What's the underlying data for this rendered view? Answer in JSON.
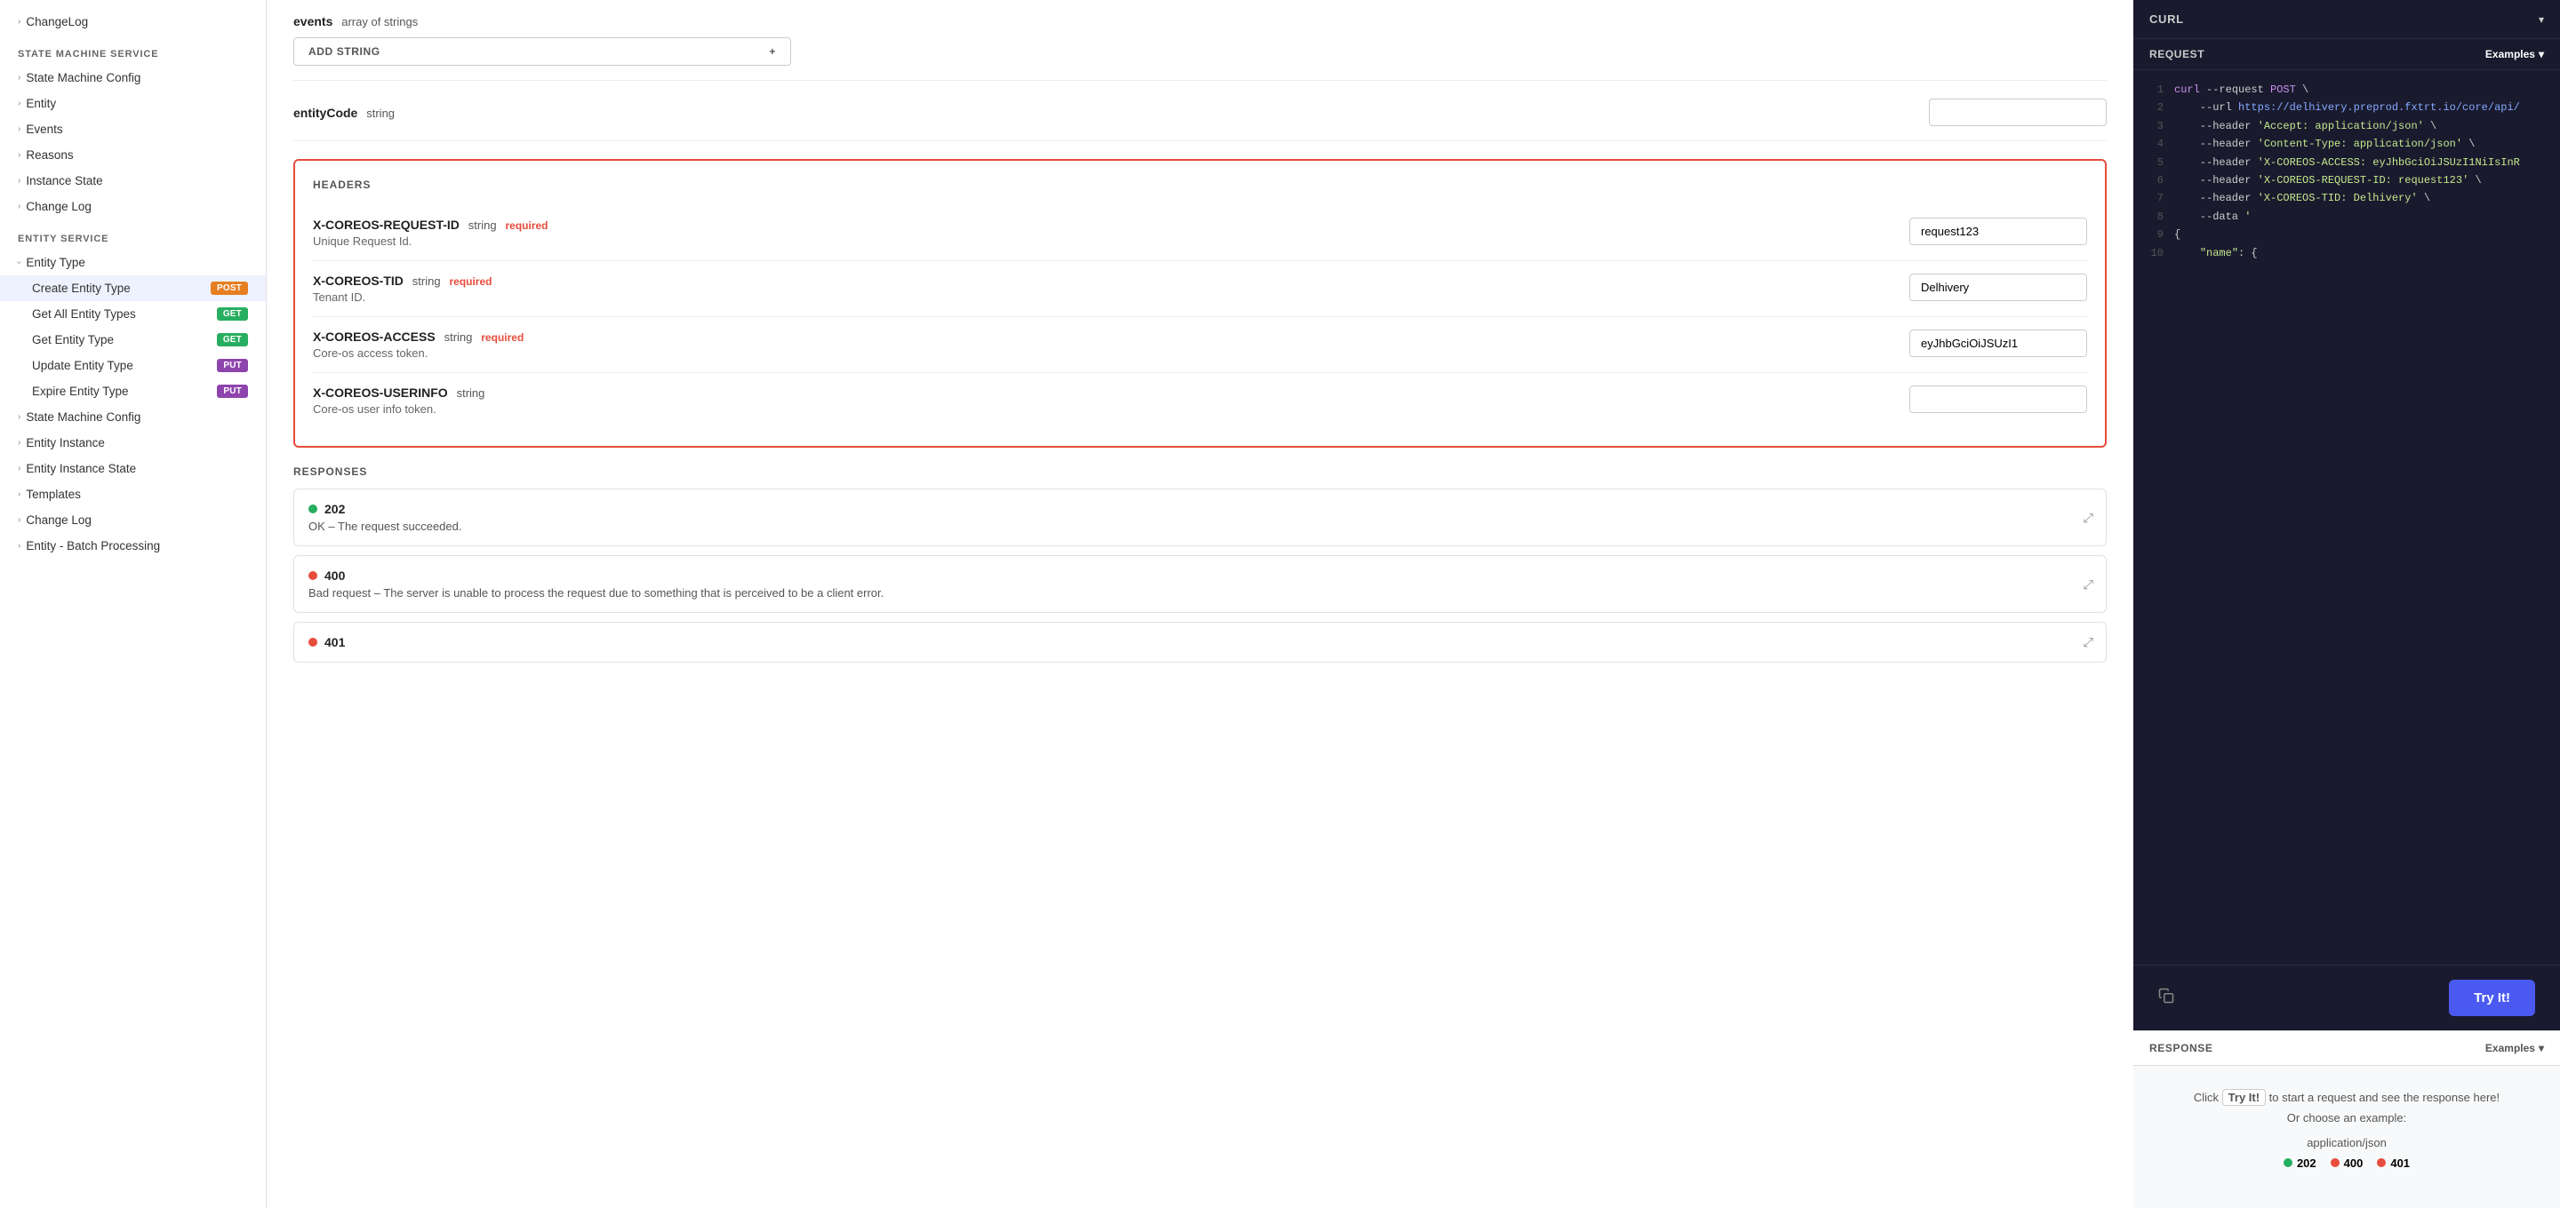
{
  "sidebar": {
    "top_item": "ChangeLog",
    "sections": [
      {
        "title": "STATE MACHINE SERVICE",
        "items": [
          {
            "label": "State Machine Config",
            "type": "parent"
          },
          {
            "label": "Entity",
            "type": "parent"
          },
          {
            "label": "Events",
            "type": "parent"
          },
          {
            "label": "Reasons",
            "type": "parent"
          },
          {
            "label": "Instance State",
            "type": "parent"
          },
          {
            "label": "Change Log",
            "type": "parent"
          }
        ]
      },
      {
        "title": "ENTITY SERVICE",
        "items": [
          {
            "label": "Entity Type",
            "type": "expandable",
            "expanded": true,
            "children": [
              {
                "label": "Create Entity Type",
                "badge": "POST",
                "badgeClass": "badge-post",
                "active": true
              },
              {
                "label": "Get All Entity Types",
                "badge": "GET",
                "badgeClass": "badge-get"
              },
              {
                "label": "Get Entity Type",
                "badge": "GET",
                "badgeClass": "badge-get"
              },
              {
                "label": "Update Entity Type",
                "badge": "PUT",
                "badgeClass": "badge-put"
              },
              {
                "label": "Expire Entity Type",
                "badge": "PUT",
                "badgeClass": "badge-put"
              }
            ]
          },
          {
            "label": "State Machine Config",
            "type": "parent"
          },
          {
            "label": "Entity Instance",
            "type": "parent"
          },
          {
            "label": "Entity Instance State",
            "type": "parent"
          },
          {
            "label": "Templates",
            "type": "parent"
          },
          {
            "label": "Change Log",
            "type": "parent"
          },
          {
            "label": "Entity - Batch Processing",
            "type": "parent"
          }
        ]
      }
    ]
  },
  "main": {
    "events_field": {
      "label": "events",
      "type": "array of strings",
      "add_string_label": "ADD STRING",
      "add_icon": "+"
    },
    "entity_code_field": {
      "label": "entityCode",
      "type": "string",
      "value": ""
    },
    "headers_section": {
      "title": "HEADERS",
      "fields": [
        {
          "name": "X-COREOS-REQUEST-ID",
          "type": "string",
          "required": true,
          "required_label": "required",
          "description": "Unique Request Id.",
          "value": "request123"
        },
        {
          "name": "X-COREOS-TID",
          "type": "string",
          "required": true,
          "required_label": "required",
          "description": "Tenant ID.",
          "value": "Delhivery"
        },
        {
          "name": "X-COREOS-ACCESS",
          "type": "string",
          "required": true,
          "required_label": "required",
          "description": "Core-os access token.",
          "value": "eyJhbGciOiJSUzI1"
        },
        {
          "name": "X-COREOS-USERINFO",
          "type": "string",
          "required": false,
          "description": "Core-os user info token.",
          "value": ""
        }
      ]
    },
    "responses_section": {
      "title": "RESPONSES",
      "items": [
        {
          "code": "202",
          "dot_class": "dot-green",
          "description": "OK – The request succeeded."
        },
        {
          "code": "400",
          "dot_class": "dot-red",
          "description": "Bad request – The server is unable to process the request due to something that is perceived to be a client error."
        },
        {
          "code": "401",
          "dot_class": "dot-red",
          "description": ""
        }
      ]
    }
  },
  "right_panel": {
    "curl_label": "CURL",
    "request_label": "REQUEST",
    "examples_label": "Examples",
    "code_lines": [
      {
        "num": "1",
        "text": "curl --request POST \\"
      },
      {
        "num": "2",
        "text": "    --url https://delhivery.preprod.fxtrt.io/core/api/"
      },
      {
        "num": "3",
        "text": "    --header 'Accept: application/json' \\"
      },
      {
        "num": "4",
        "text": "    --header 'Content-Type: application/json' \\"
      },
      {
        "num": "5",
        "text": "    --header 'X-COREOS-ACCESS: eyJhbGciOiJSUzI1NiIsInR"
      },
      {
        "num": "6",
        "text": "    --header 'X-COREOS-REQUEST-ID: request123' \\"
      },
      {
        "num": "7",
        "text": "    --header 'X-COREOS-TID: Delhivery' \\"
      },
      {
        "num": "8",
        "text": "    --data '"
      },
      {
        "num": "9",
        "text": "{"
      },
      {
        "num": "10",
        "text": "    \"name\": {"
      }
    ],
    "try_it_label": "Try It!",
    "response_label": "RESPONSE",
    "response_examples_label": "Examples",
    "response_hint_prefix": "Click ",
    "response_hint_try": "Try It!",
    "response_hint_suffix": " to start a request and see the response here!",
    "response_or": "Or choose an example:",
    "response_content_type": "application/json",
    "response_codes": [
      {
        "code": "202",
        "dot_class": "dot-green"
      },
      {
        "code": "400",
        "dot_class": "dot-red"
      },
      {
        "code": "401",
        "dot_class": "dot-red"
      }
    ]
  }
}
